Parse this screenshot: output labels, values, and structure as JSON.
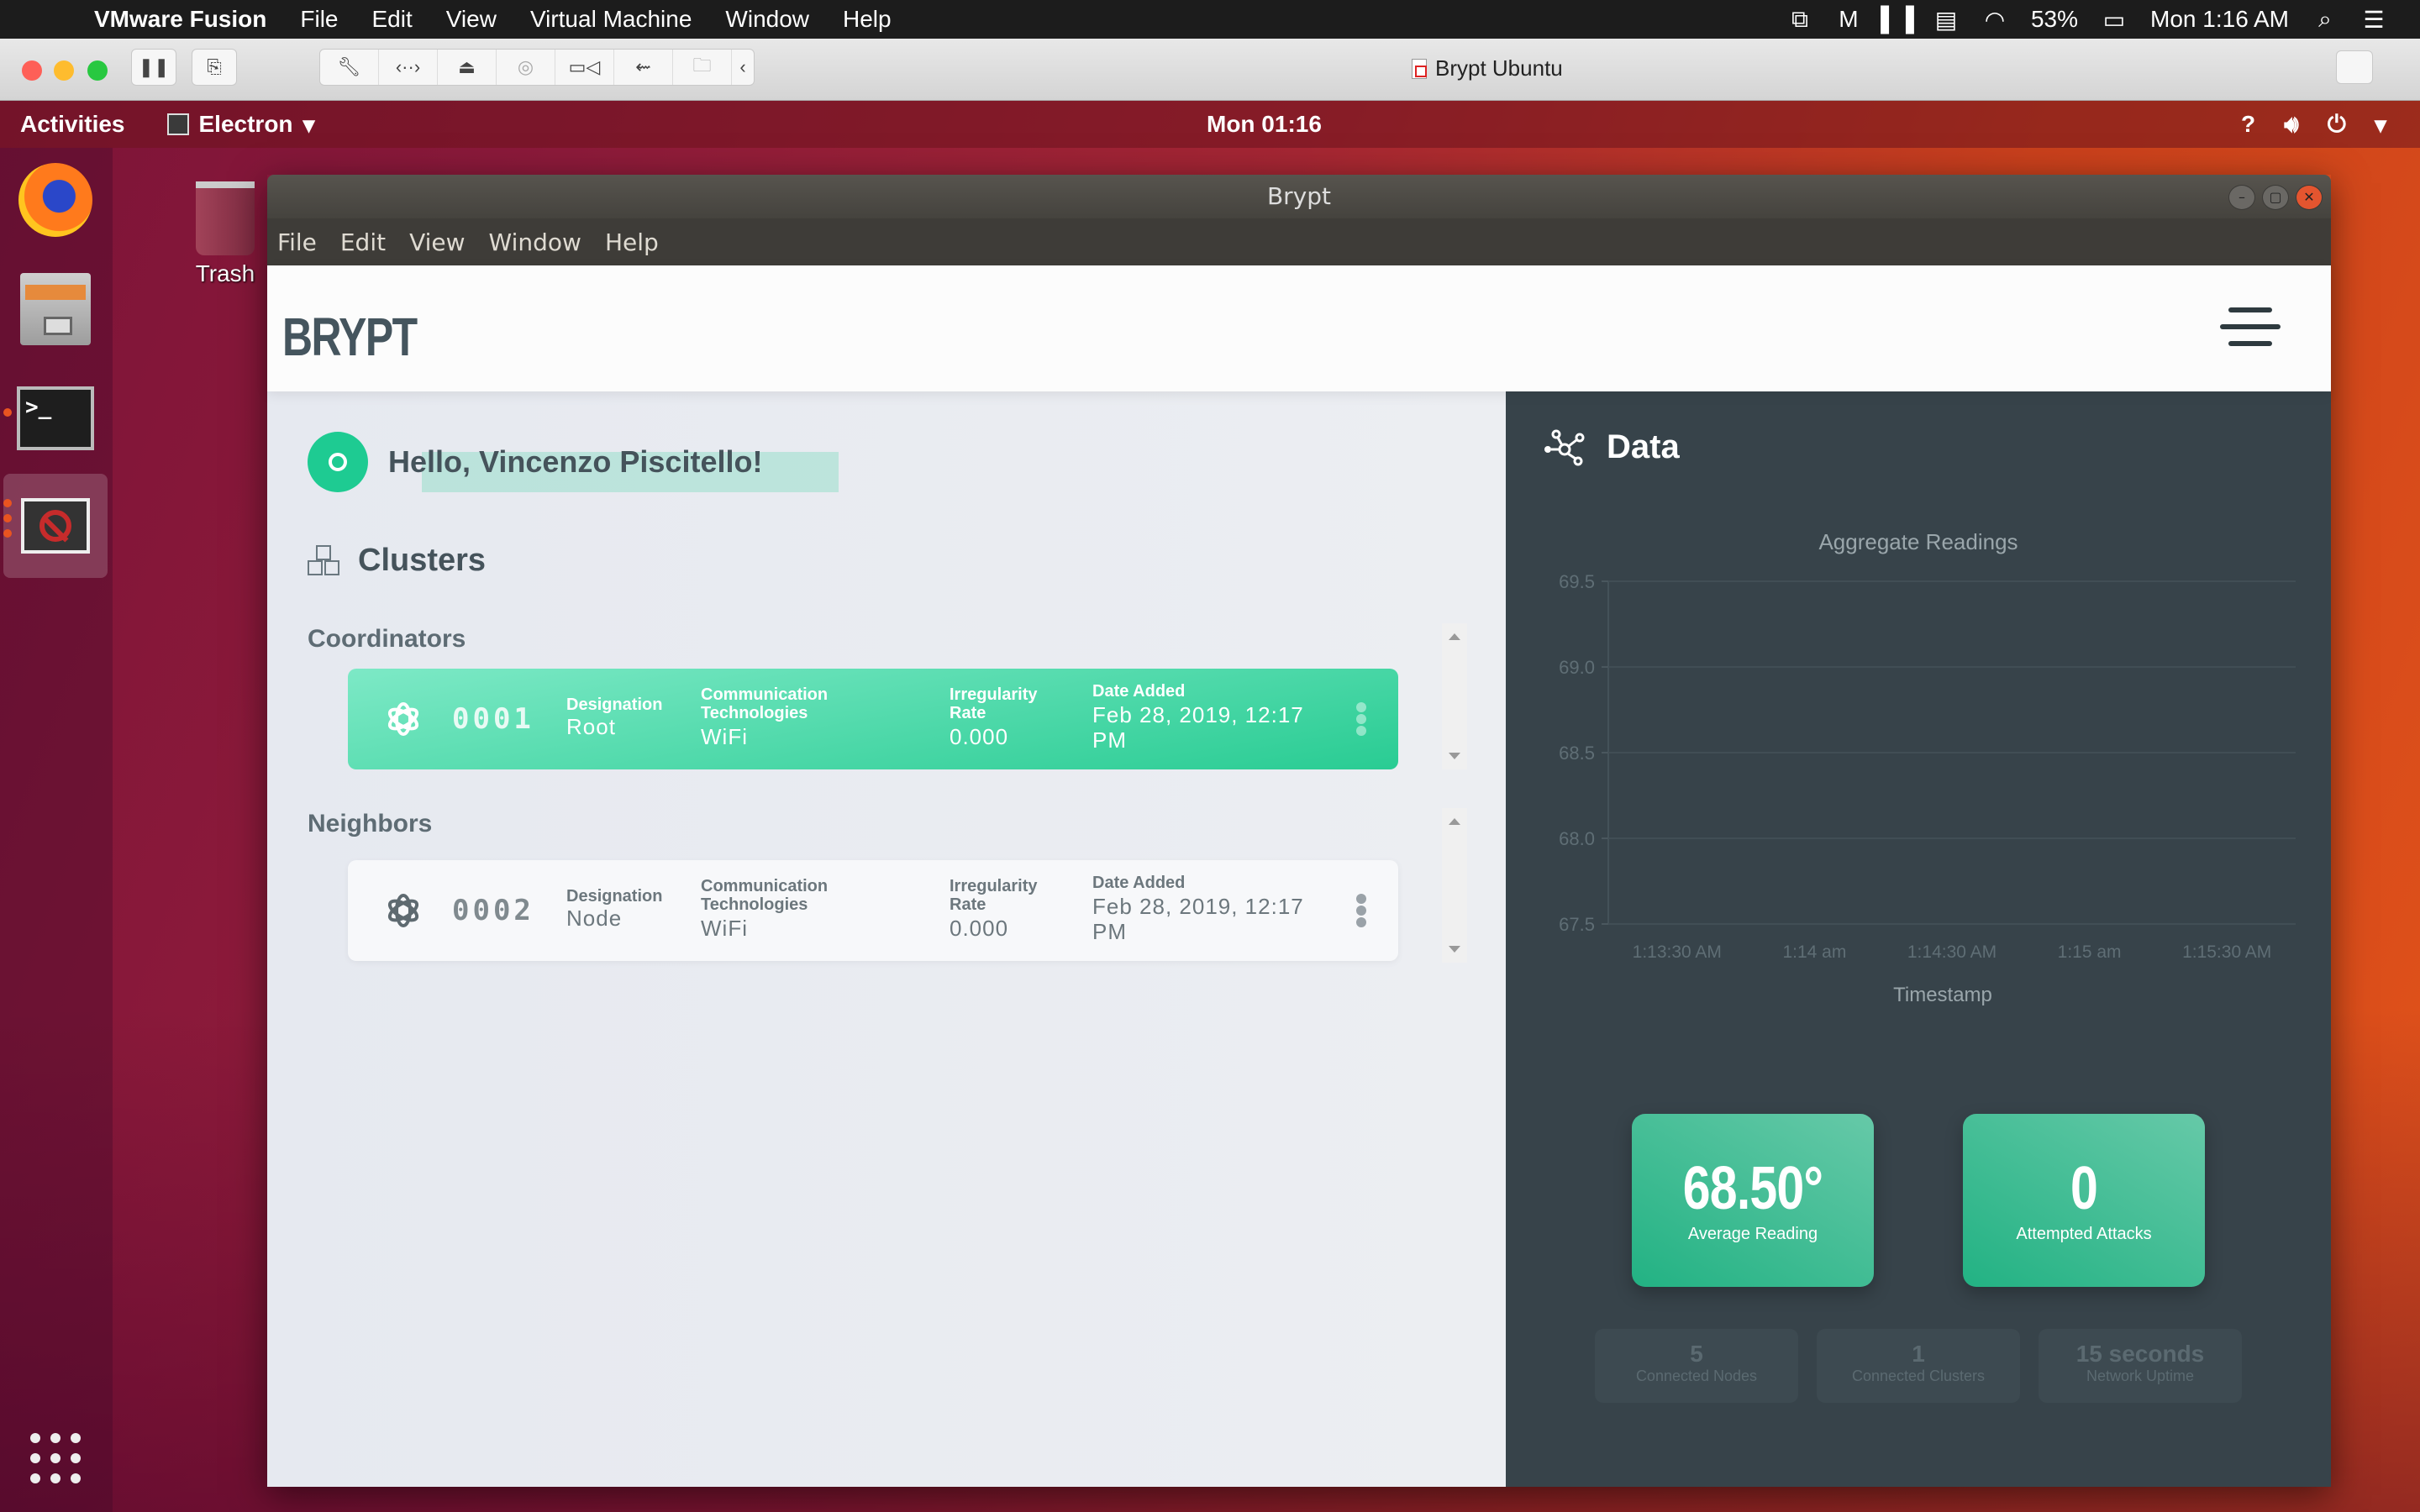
{
  "mac_menubar": {
    "app_name": "VMware Fusion",
    "menus": [
      "File",
      "Edit",
      "View",
      "Virtual Machine",
      "Window",
      "Help"
    ],
    "battery_percent": "53%",
    "clock": "Mon 1:16 AM"
  },
  "vmware": {
    "window_title": "Brypt Ubuntu",
    "toolbar_icons": [
      "pause-icon",
      "snapshot-icon",
      "settings-wrench-icon",
      "network-icon",
      "hard-disk-icon",
      "cd-dvd-icon",
      "camera-icon",
      "usb-icon",
      "shared-folder-icon",
      "collapse-chevron-icon"
    ]
  },
  "ubuntu_bar": {
    "activities": "Activities",
    "app_menu": "Electron",
    "clock": "Mon 01:16",
    "tray_icons": [
      "help-icon",
      "volume-icon",
      "power-icon",
      "dropdown-icon"
    ]
  },
  "dock": {
    "items": [
      "Firefox",
      "Files",
      "Terminal",
      "Electron"
    ]
  },
  "desktop": {
    "trash_label": "Trash"
  },
  "app_window": {
    "title": "Brypt",
    "menus": [
      "File",
      "Edit",
      "View",
      "Window",
      "Help"
    ]
  },
  "app": {
    "logo": "BRYPT",
    "greeting": "Hello, Vincenzo Piscitello!",
    "clusters_title": "Clusters",
    "coordinators_label": "Coordinators",
    "neighbors_label": "Neighbors",
    "field_labels": {
      "designation": "Designation",
      "comm_tech_1": "Communication",
      "comm_tech_2": "Technologies",
      "irregularity_1": "Irregularity",
      "irregularity_2": "Rate",
      "date_added": "Date Added"
    },
    "coordinators": [
      {
        "id": "0001",
        "designation": "Root",
        "comm_tech": "WiFi",
        "irregularity_rate": "0.000",
        "date_line1": "Feb 28, 2019, 12:17",
        "date_line2": "PM"
      }
    ],
    "neighbors": [
      {
        "id": "0002",
        "designation": "Node",
        "comm_tech": "WiFi",
        "irregularity_rate": "0.000",
        "date_line1": "Feb 28, 2019, 12:17",
        "date_line2": "PM"
      }
    ],
    "data_panel": {
      "title": "Data",
      "average_reading": "68.50°",
      "average_reading_label": "Average Reading",
      "attempted_attacks": "0",
      "attempted_attacks_label": "Attempted Attacks",
      "stats": [
        {
          "value": "5",
          "label": "Connected Nodes"
        },
        {
          "value": "1",
          "label": "Connected Clusters"
        },
        {
          "value": "15 seconds",
          "label": "Network Uptime"
        }
      ]
    },
    "colors": {
      "accent": "#1ecb92",
      "panel_dark": "#37434a",
      "text_dark": "#45535b"
    }
  },
  "chart_data": {
    "type": "line",
    "title": "Aggregate Readings",
    "xlabel": "Timestamp",
    "ylabel": "",
    "x_ticks": [
      "1:13:30 AM",
      "1:14 am",
      "1:14:30 AM",
      "1:15 am",
      "1:15:30 AM"
    ],
    "y_ticks": [
      "69.5",
      "69.0",
      "68.5",
      "68.0",
      "67.5"
    ],
    "ylim": [
      67.5,
      69.5
    ],
    "series": [],
    "grid": true,
    "legend": "none"
  }
}
